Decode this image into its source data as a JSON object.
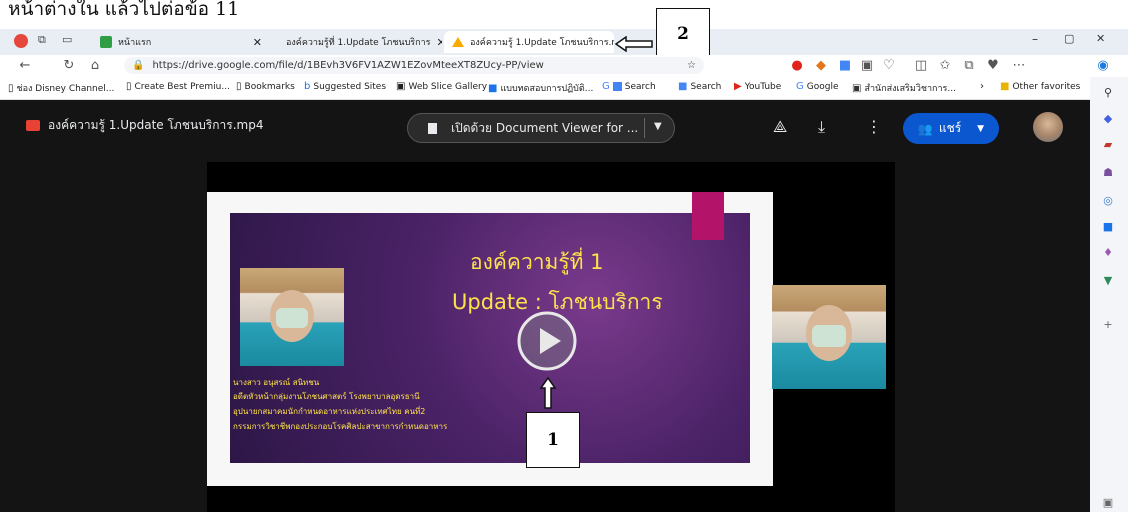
{
  "heading": "หน้าต่างใน แล้วไปต่อข้อ 11",
  "tabs": [
    {
      "label": "หน้าแรก",
      "color": "#2f9e44"
    },
    {
      "label": "องค์ความรู้ที่ 1.Update โภชนบริการ",
      "color": "#1a73e8"
    },
    {
      "label": "องค์ความรู้ 1.Update โภชนบริการ.m",
      "color": "#f9ab00"
    }
  ],
  "window_controls": {
    "minimize": "–",
    "maximize": "▢",
    "close": "✕"
  },
  "address": {
    "url": "https://drive.google.com/file/d/1BEvh3V6FV1AZW1EZovMteeXT8ZUcy-PP/view"
  },
  "favorites": [
    "ช่อง Disney Channel...",
    "Create Best Premiu...",
    "Bookmarks",
    "Suggested Sites",
    "Web Slice Gallery",
    "แบบทดสอบการปฏิบัติ...",
    "Search",
    "Search",
    "YouTube",
    "Google",
    "สำนักส่งเสริมวิชาการ...",
    "Other favorites"
  ],
  "viewer": {
    "file_title": "องค์ความรู้ 1.Update โภชนบริการ.mp4",
    "open_with": "เปิดด้วย Document Viewer for ...",
    "share_label": "แชร์"
  },
  "slide": {
    "line1": "องค์ความรู้ที่ 1",
    "line2": "Update : โภชนบริการ",
    "credits": [
      "นางสาว อนุสรณ์ สนิทชน",
      "อดีตหัวหน้ากลุ่มงานโภชนศาสตร์ โรงพยาบาลอุดรธานี",
      "อุปนายกสมาคมนักกำหนดอาหารแห่งประเทศไทย คนที่2",
      "กรรมการวิชาชีพกองประกอบโรคศิลปะสาขาการกำหนดอาหาร"
    ]
  },
  "callouts": {
    "one": "1",
    "two": "2"
  },
  "colors": {
    "share_blue": "#0b57d0",
    "viewer_bg": "#141414",
    "accent_pink": "#b3146a",
    "slide_text": "#ffe24a"
  }
}
